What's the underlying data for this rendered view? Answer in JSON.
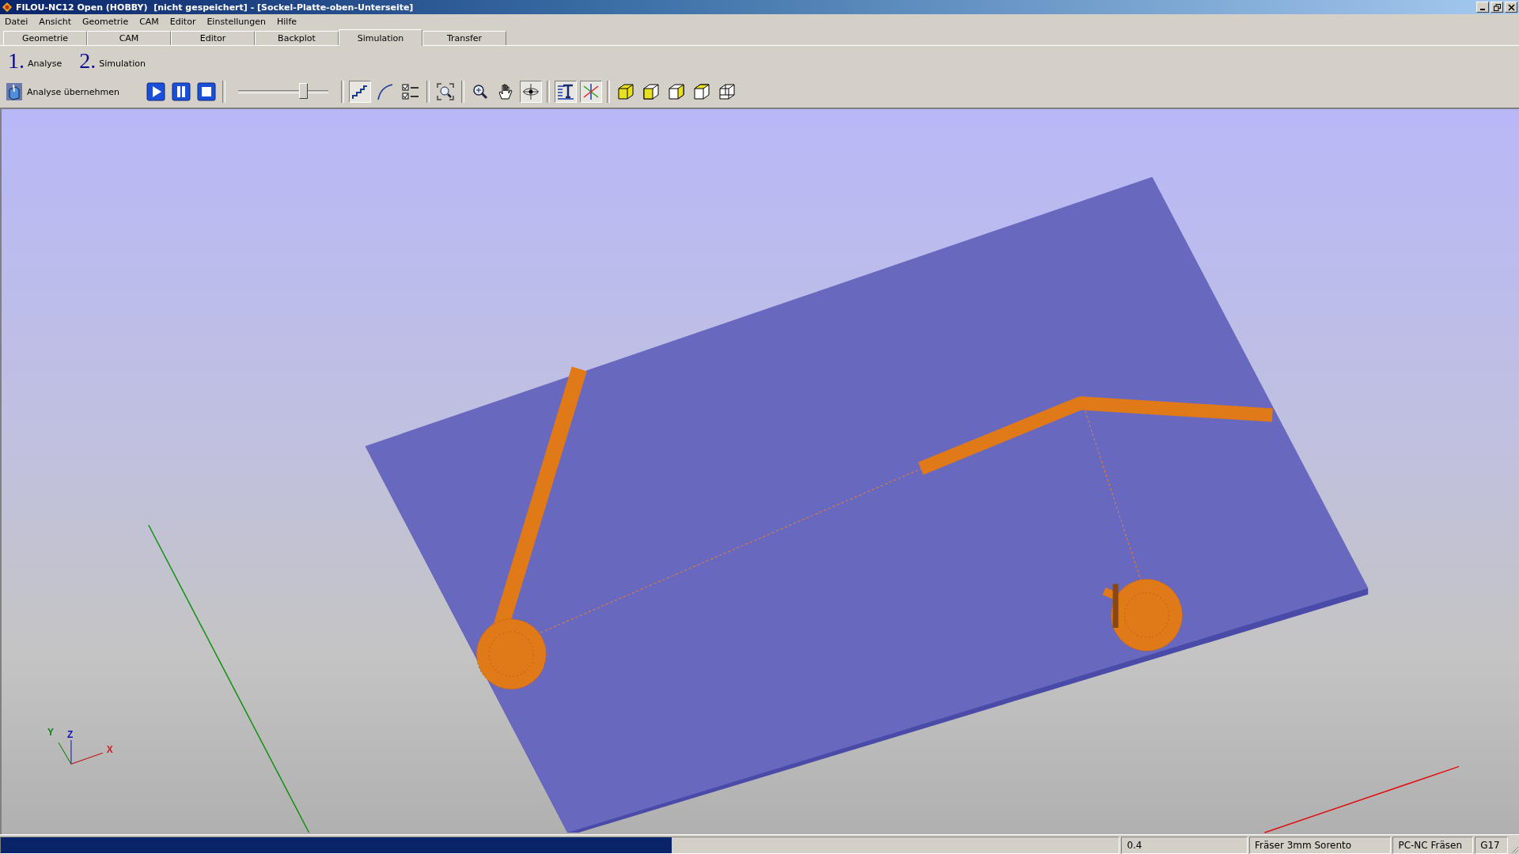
{
  "window": {
    "title": "FILOU-NC12 Open (HOBBY)  [nicht gespeichert] - [Sockel-Platte-oben-Unterseite]"
  },
  "menu": [
    "Datei",
    "Ansicht",
    "Geometrie",
    "CAM",
    "Editor",
    "Einstellungen",
    "Hilfe"
  ],
  "tabs": [
    {
      "label": "Geometrie",
      "selected": false
    },
    {
      "label": "CAM",
      "selected": false
    },
    {
      "label": "Editor",
      "selected": false
    },
    {
      "label": "Backplot",
      "selected": false
    },
    {
      "label": "Simulation",
      "selected": true
    },
    {
      "label": "Transfer",
      "selected": false
    }
  ],
  "steps": [
    {
      "number": "1.",
      "label": "Analyse"
    },
    {
      "number": "2.",
      "label": "Simulation"
    }
  ],
  "toolbar": {
    "analyse_button": "Analyse übernehmen",
    "speed_slider": {
      "level": 0.72
    },
    "tools": [
      {
        "kind": "play",
        "pressed": false
      },
      {
        "kind": "pause",
        "pressed": false
      },
      {
        "kind": "stop",
        "pressed": false
      },
      {
        "kind": "slider"
      },
      {
        "kind": "steps",
        "pressed": true
      },
      {
        "kind": "arc",
        "pressed": false
      },
      {
        "kind": "checklist",
        "pressed": false
      },
      {
        "kind": "zoomfit",
        "pressed": false
      },
      {
        "kind": "zoom",
        "pressed": false
      },
      {
        "kind": "hand",
        "pressed": false
      },
      {
        "kind": "rotate",
        "pressed": true
      },
      {
        "kind": "text",
        "pressed": true
      },
      {
        "kind": "axes",
        "pressed": true
      },
      {
        "kind": "cube",
        "pressed": false
      },
      {
        "kind": "cubefront",
        "pressed": false
      },
      {
        "kind": "cubeside",
        "pressed": false
      },
      {
        "kind": "cubetop",
        "pressed": false
      },
      {
        "kind": "cubeiso",
        "pressed": false
      }
    ]
  },
  "viewport": {
    "axes": [
      "X",
      "Y",
      "Z"
    ]
  },
  "status_bar": {
    "progress": {
      "level": 0.6
    },
    "fields": [
      "0.4",
      "Fräser 3mm Sorento",
      "PC-NC Fräsen",
      "G17"
    ]
  }
}
